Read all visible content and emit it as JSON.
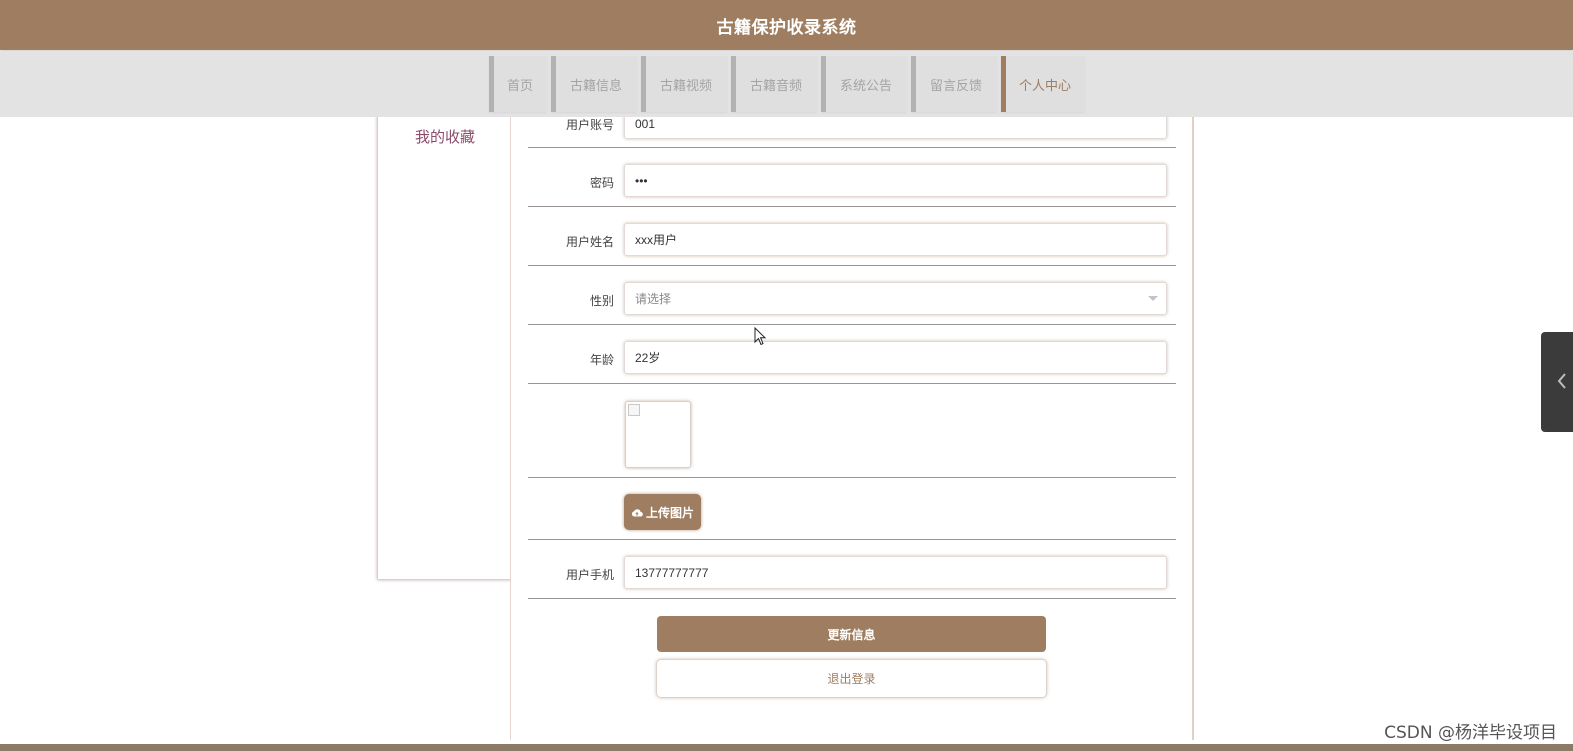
{
  "header": {
    "title": "古籍保护收录系统"
  },
  "nav": {
    "items": [
      {
        "label": "首页"
      },
      {
        "label": "古籍信息"
      },
      {
        "label": "古籍视频"
      },
      {
        "label": "古籍音频"
      },
      {
        "label": "系统公告"
      },
      {
        "label": "留言反馈"
      },
      {
        "label": "个人中心"
      }
    ],
    "active": "个人中心"
  },
  "sidebar": {
    "items": [
      {
        "label": "我的收藏"
      }
    ]
  },
  "form": {
    "account": {
      "label": "用户账号",
      "value": "001"
    },
    "password": {
      "label": "密码",
      "value": "•••"
    },
    "name": {
      "label": "用户姓名",
      "value": "xxx用户"
    },
    "gender": {
      "label": "性别",
      "placeholder": "请选择"
    },
    "age": {
      "label": "年龄",
      "value": "22岁"
    },
    "upload_label": "上传图片",
    "phone": {
      "label": "用户手机",
      "value": "13777777777"
    },
    "update_button": "更新信息",
    "logout_button": "退出登录"
  },
  "watermark": "CSDN @杨洋毕设项目",
  "colors": {
    "brand": "#9e7d60",
    "nav_bg": "#e4e3e4",
    "side_tab": "#3b3b3b"
  },
  "icons": {
    "upload": "cloud-upload-icon",
    "side_tab": "chevron-left-icon",
    "select": "caret-down-icon"
  }
}
